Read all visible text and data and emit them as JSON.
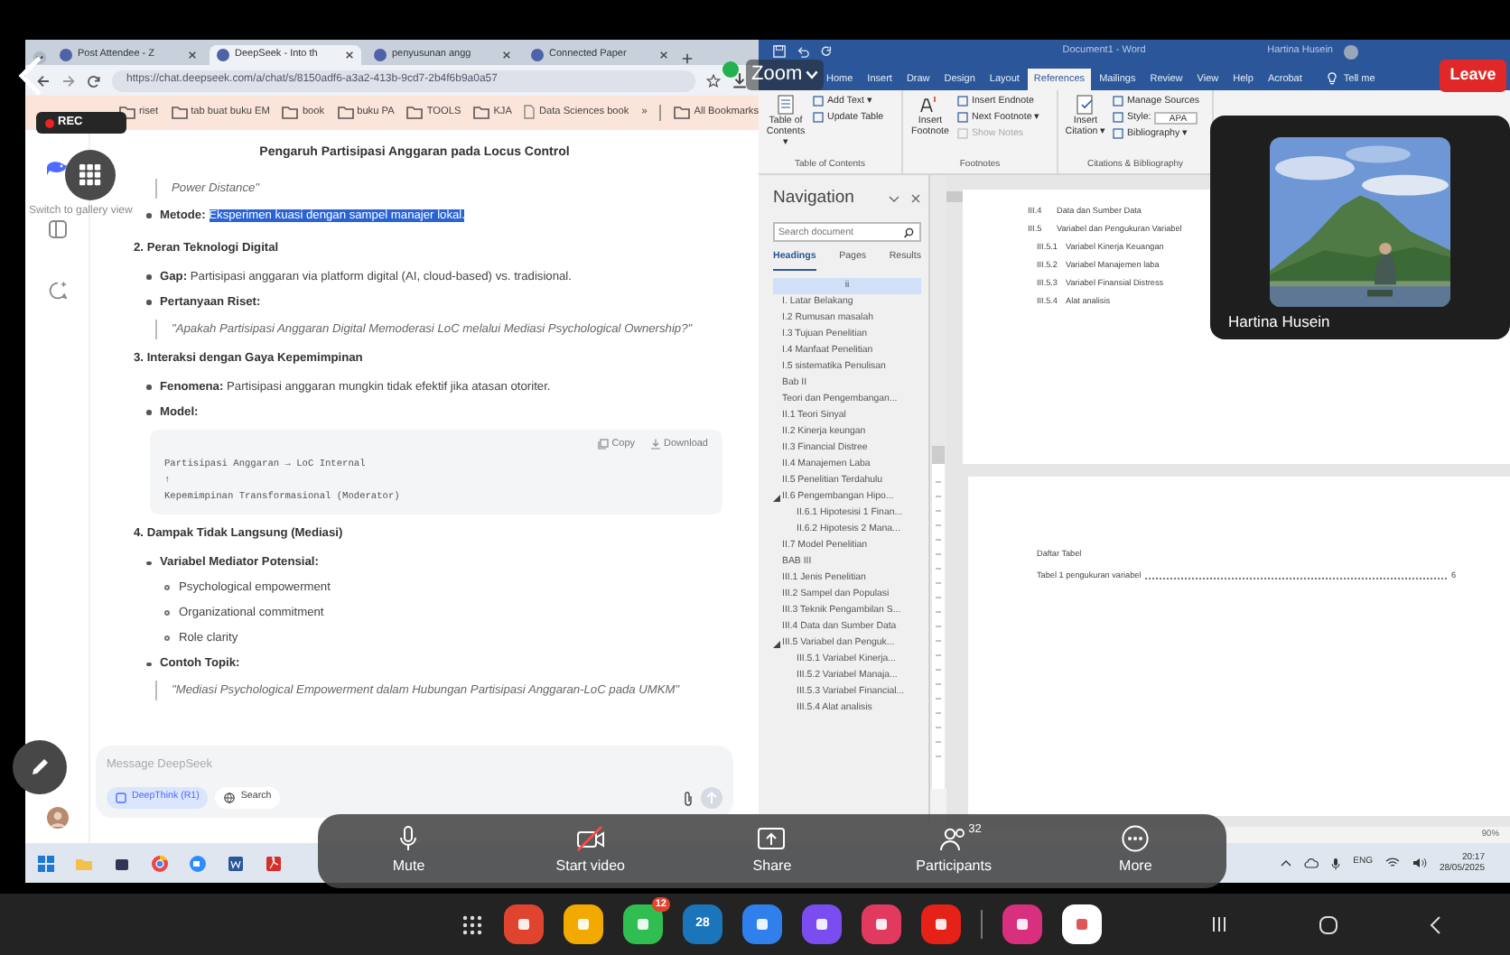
{
  "zoom": {
    "title": "Zoom",
    "leave": "Leave",
    "rec": "REC",
    "gallery_hint": "Switch to gallery view",
    "video": {
      "name": "Hartina Husein",
      "kind": "picture"
    },
    "toolbar": [
      {
        "label": "Mute"
      },
      {
        "label": "Start video"
      },
      {
        "label": "Share"
      },
      {
        "label": "Participants",
        "badge": "32"
      },
      {
        "label": "More"
      }
    ]
  },
  "browser": {
    "tabs": [
      {
        "label": "Post Attendee - Z",
        "selected": false
      },
      {
        "label": "DeepSeek - Into th",
        "selected": true
      },
      {
        "label": "penyusunan angg",
        "selected": false
      },
      {
        "label": "Connected Paper",
        "selected": false
      }
    ],
    "url": "https://chat.deepseek.com/a/chat/s/8150adf6-a3a2-413b-9cd7-2b4f6b9a0a57",
    "bookmarks": [
      {
        "label": "riset",
        "kind": "folder"
      },
      {
        "label": "tab buat buku EM",
        "kind": "folder"
      },
      {
        "label": "book",
        "kind": "folder"
      },
      {
        "label": "buku PA",
        "kind": "folder"
      },
      {
        "label": "TOOLS",
        "kind": "folder"
      },
      {
        "label": "KJA",
        "kind": "folder"
      },
      {
        "label": "Data Sciences book",
        "kind": "page"
      },
      {
        "label": "»",
        "kind": "more"
      },
      {
        "label": "All Bookmarks",
        "kind": "folder"
      }
    ]
  },
  "chat": {
    "title": "Pengaruh Partisipasi Anggaran pada Locus Control",
    "blocks": [
      {
        "kind": "quote",
        "text": "Power Distance\""
      },
      {
        "kind": "bullet",
        "label": "Metode:",
        "text": "Eksperimen kuasi dengan sampel manajer lokal.",
        "highlighted": true
      },
      {
        "kind": "heading",
        "text": "2. Peran Teknologi Digital"
      },
      {
        "kind": "bullet",
        "label": "Gap:",
        "text": "Partisipasi anggaran via platform digital (AI, cloud-based) vs. tradisional.",
        "highlighted": false
      },
      {
        "kind": "bullet",
        "label": "Pertanyaan Riset:"
      },
      {
        "kind": "quote",
        "text": "\"Apakah Partisipasi Anggaran Digital Memoderasi LoC melalui Mediasi Psychological Ownership?\""
      },
      {
        "kind": "heading",
        "text": "3. Interaksi dengan Gaya Kepemimpinan"
      },
      {
        "kind": "bullet",
        "label": "Fenomena:",
        "text": "Partisipasi anggaran mungkin tidak efektif jika atasan otoriter.",
        "highlighted": false
      },
      {
        "kind": "bullet",
        "label": "Model:"
      },
      {
        "kind": "code",
        "copy": "Copy",
        "download": "Download",
        "lines": [
          "Partisipasi Anggaran → LoC Internal",
          "↑",
          "Kepemimpinan Transformasional (Moderator)"
        ]
      },
      {
        "kind": "heading",
        "text": "4. Dampak Tidak Langsung (Mediasi)"
      },
      {
        "kind": "bullet",
        "label": "Variabel Mediator Potensial:"
      },
      {
        "kind": "subbullet",
        "text": "Psychological empowerment"
      },
      {
        "kind": "subbullet",
        "text": "Organizational commitment"
      },
      {
        "kind": "subbullet",
        "text": "Role clarity"
      },
      {
        "kind": "bullet",
        "label": "Contoh Topik:"
      },
      {
        "kind": "quote",
        "text": "\"Mediasi Psychological Empowerment dalam Hubungan Partisipasi Anggaran-LoC pada UMKM\""
      }
    ],
    "input": {
      "placeholder": "Message DeepSeek",
      "deepthink": "DeepThink (R1)",
      "search": "Search"
    }
  },
  "word": {
    "title": "Document1 - Word",
    "user": "Hartina Husein",
    "tabs": [
      {
        "label": "Home",
        "selected": false
      },
      {
        "label": "Insert",
        "selected": false
      },
      {
        "label": "Draw",
        "selected": false
      },
      {
        "label": "Design",
        "selected": false
      },
      {
        "label": "Layout",
        "selected": false
      },
      {
        "label": "References",
        "selected": true
      },
      {
        "label": "Mailings",
        "selected": false
      },
      {
        "label": "Review",
        "selected": false
      },
      {
        "label": "View",
        "selected": false
      },
      {
        "label": "Help",
        "selected": false
      },
      {
        "label": "Acrobat",
        "selected": false
      }
    ],
    "tell_me": "Tell me",
    "ribbon": [
      {
        "label": "Table of Contents",
        "big": "Table of Contents ▾",
        "small": [
          {
            "text": "Add Text ▾",
            "disabled": false
          },
          {
            "text": "Update Table",
            "disabled": false
          }
        ]
      },
      {
        "label": "Footnotes",
        "big": "Insert Footnote",
        "small": [
          {
            "text": "Insert Endnote",
            "disabled": false
          },
          {
            "text": "Next Footnote ▾",
            "disabled": false
          },
          {
            "text": "Show Notes",
            "disabled": true
          }
        ]
      },
      {
        "label": "Citations & Bibliography",
        "big": "Insert Citation ▾",
        "small": [
          {
            "text": "Manage Sources",
            "disabled": false
          },
          {
            "text": "Style:",
            "value": "APA",
            "disabled": false
          },
          {
            "text": "Bibliography ▾",
            "disabled": false
          }
        ]
      }
    ],
    "navigation": {
      "title": "Navigation",
      "search_placeholder": "Search document",
      "tabs": [
        {
          "label": "Headings",
          "selected": true
        },
        {
          "label": "Pages",
          "selected": false
        },
        {
          "label": "Results",
          "selected": false
        }
      ],
      "tree": [
        {
          "text": "ii",
          "selected": true
        },
        {
          "text": "I. Latar Belakang",
          "selected": false
        },
        {
          "text": "I.2 Rumusan masalah",
          "selected": false
        },
        {
          "text": "I.3 Tujuan Penelitian",
          "selected": false
        },
        {
          "text": "I.4 Manfaat Penelitian",
          "selected": false
        },
        {
          "text": "I.5 sistematika Penulisan",
          "selected": false
        },
        {
          "text": "Bab II",
          "selected": false
        },
        {
          "text": "Teori dan Pengembangan...",
          "selected": false
        },
        {
          "text": "II.1 Teori Sinyal",
          "selected": false
        },
        {
          "text": "II.2 Kinerja keungan",
          "selected": false
        },
        {
          "text": "II.3 Financial Distree",
          "selected": false
        },
        {
          "text": "II.4 Manajemen Laba",
          "selected": false
        },
        {
          "text": "II.5 Penelitian Terdahulu",
          "selected": false
        },
        {
          "text": "II.6 Pengembangan Hipo...",
          "selected": false,
          "expanded": true,
          "children": [
            {
              "text": "II.6.1 Hipotesisi 1 Finan...",
              "selected": false
            },
            {
              "text": "II.6.2 Hipotesis 2 Mana...",
              "selected": false
            }
          ]
        },
        {
          "text": "II.7 Model Penelitian",
          "selected": false
        },
        {
          "text": "BAB III",
          "selected": false
        },
        {
          "text": "III.1 Jenis Penelitian",
          "selected": false
        },
        {
          "text": "III.2 Sampel dan Populasi",
          "selected": false
        },
        {
          "text": "III.3 Teknik Pengambilan S...",
          "selected": false
        },
        {
          "text": "III.4 Data dan Sumber Data",
          "selected": false
        },
        {
          "text": "III.5  Variabel dan Penguk...",
          "selected": false,
          "expanded": true,
          "children": [
            {
              "text": "III.5.1 Variabel Kinerja...",
              "selected": false
            },
            {
              "text": "III.5.2 Variabel Manaja...",
              "selected": false
            },
            {
              "text": "III.5.3 Variabel Financial...",
              "selected": false
            },
            {
              "text": "III.5.4 Alat analisis",
              "selected": false
            }
          ]
        }
      ]
    },
    "toc": [
      {
        "number": "III.4",
        "text": "Data dan Sumber Data",
        "indented": false
      },
      {
        "number": "III.5",
        "text": "Variabel dan Pengukuran Variabel",
        "indented": false
      },
      {
        "number": "III.5.1",
        "text": "Variabel Kinerja Keuangan",
        "indented": true
      },
      {
        "number": "III.5.2",
        "text": "Variabel Manajemen laba",
        "indented": true
      },
      {
        "number": "III.5.3",
        "text": "Variabel Finansial Distress",
        "indented": true
      },
      {
        "number": "III.5.4",
        "text": "Alat analisis",
        "indented": true
      }
    ],
    "table_list": {
      "title": "Daftar Tabel",
      "entries": [
        {
          "text": "Tabel 1 pengukuran variabel",
          "page": "6"
        }
      ]
    },
    "status": {
      "zoom": "90%"
    }
  },
  "taskbar": {
    "language": "ENG",
    "time": "20:17",
    "date": "28/05/2025"
  },
  "android": {
    "dock": [
      {
        "color": "#e0442f"
      },
      {
        "color": "#f2a900"
      },
      {
        "color": "#2fbe4f",
        "badge": "12"
      },
      {
        "color": "#1b75bb",
        "label": "28"
      },
      {
        "color": "#2f80ed"
      },
      {
        "color": "#7b4df0"
      },
      {
        "color": "#e23a5f"
      },
      {
        "color": "#e62117"
      },
      {
        "color": "#d8307f",
        "divider_before": true
      },
      {
        "color": "#ffffff"
      }
    ]
  }
}
